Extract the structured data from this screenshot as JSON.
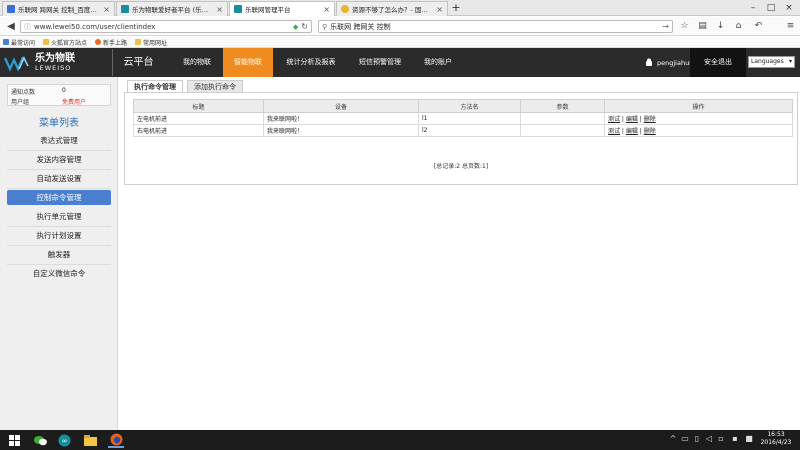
{
  "browser": {
    "tabs": [
      {
        "title": "乐联网 跨网关 控制_百度…",
        "active": false,
        "favicon_color": "#3b6fd6"
      },
      {
        "title": "乐为物联爱好者平台 (乐…",
        "active": false,
        "favicon_color": "#1b8c99"
      },
      {
        "title": "乐联网管理平台",
        "active": true,
        "favicon_color": "#1b8c99"
      },
      {
        "title": "资源不够了怎么办？- 国…",
        "active": false,
        "favicon_color": "#e8b531"
      }
    ],
    "url": "www.lewei50.com/user/clientindex",
    "search_query": "乐联网 跨网关 控制",
    "bookmarks": [
      "最常访问",
      "火狐官方站点",
      "新手上路",
      "常用网址"
    ]
  },
  "site": {
    "logo_cn": "乐为物联",
    "logo_en": "LEWEISO",
    "cloud_label": "云平台",
    "nav": [
      {
        "label": "我的物联",
        "active": false
      },
      {
        "label": "智能物联",
        "active": true
      },
      {
        "label": "统计分析及报表",
        "active": false
      },
      {
        "label": "短信预警管理",
        "active": false
      },
      {
        "label": "我的账户",
        "active": false
      }
    ],
    "username": "pengjiahui",
    "logout_label": "安全退出",
    "language_label": "Languages",
    "accent_color": "#f08c1f"
  },
  "sidebar": {
    "info": [
      {
        "label": "通知点数",
        "value": "0",
        "value_color": "#222"
      },
      {
        "label": "用户组",
        "value": "免费用户",
        "value_color": "#d33"
      }
    ],
    "menu_title": "菜单列表",
    "items": [
      {
        "label": "表达式管理",
        "active": false
      },
      {
        "label": "发送内容管理",
        "active": false
      },
      {
        "label": "自动发送设置",
        "active": false
      },
      {
        "label": "控制命令管理",
        "active": true
      },
      {
        "label": "执行单元管理",
        "active": false
      },
      {
        "label": "执行计划设置",
        "active": false
      },
      {
        "label": "触发器",
        "active": false
      },
      {
        "label": "自定义微信命令",
        "active": false
      }
    ]
  },
  "content": {
    "tabs": [
      {
        "label": "执行命令管理",
        "active": true
      },
      {
        "label": "添加执行命令",
        "active": false
      }
    ],
    "table": {
      "headers": [
        "标题",
        "设备",
        "方法名",
        "参数",
        "操作"
      ],
      "rows": [
        {
          "title": "左电机前进",
          "device": "我来联网啦！",
          "method": "l1",
          "param": ""
        },
        {
          "title": "右电机前进",
          "device": "我来联网啦！",
          "method": "l2",
          "param": ""
        }
      ],
      "actions": [
        "测试",
        "编辑",
        "删除"
      ]
    },
    "pager": "[总记录:2 总页数:1]"
  },
  "taskbar": {
    "time": "16:53",
    "date": "2016/4/23"
  }
}
